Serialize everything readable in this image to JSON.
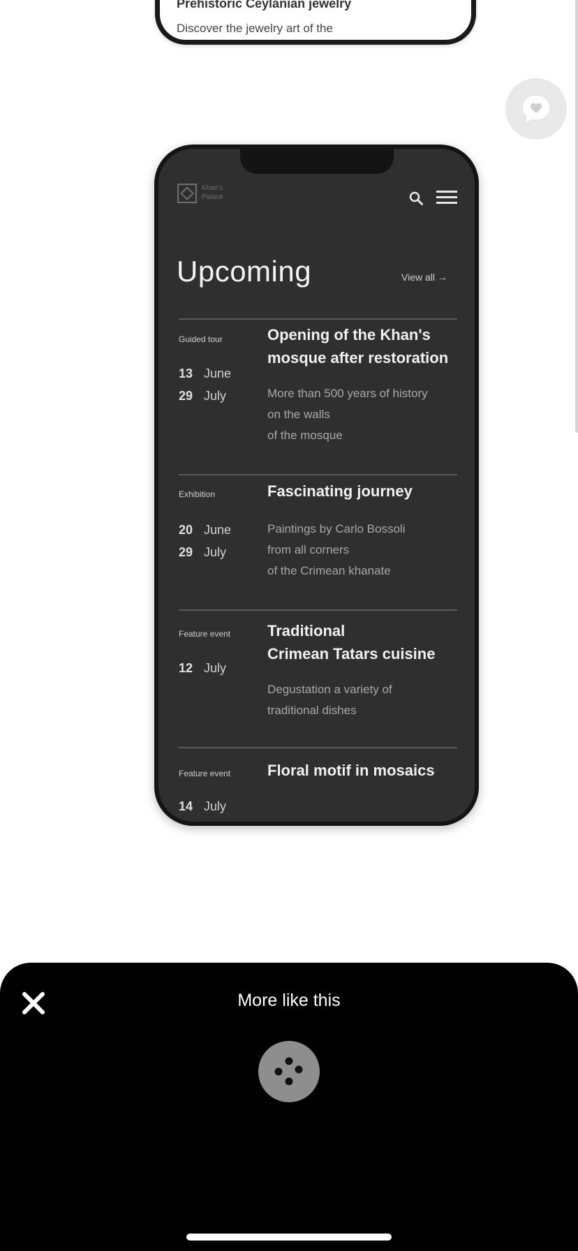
{
  "top_card": {
    "title": "Prehistoric Ceylanian jewelry",
    "description": "Discover the jewelry art of the"
  },
  "phone": {
    "logo_text_line1": "Khan's",
    "logo_text_line2": "Palace",
    "heading": "Upcoming",
    "view_all": "View all →",
    "events": [
      {
        "type": "Guided tour",
        "dates": [
          {
            "day": "13",
            "month": "June"
          },
          {
            "day": "29",
            "month": "July"
          }
        ],
        "title_line1": "Opening of the Khan's",
        "title_line2": "mosque after restoration",
        "desc_line1": "More than 500 years of history",
        "desc_line2": "on the walls",
        "desc_line3": "of the mosque"
      },
      {
        "type": "Exhibition",
        "dates": [
          {
            "day": "20",
            "month": "June"
          },
          {
            "day": "29",
            "month": "July"
          }
        ],
        "title_line1": "Fascinating journey",
        "desc_line1": "Paintings by Carlo Bossoli",
        "desc_line2": "from all corners",
        "desc_line3": "of the Crimean khanate"
      },
      {
        "type": "Feature event",
        "dates": [
          {
            "day": "12",
            "month": "July"
          }
        ],
        "title_line1": "Traditional",
        "title_line2": "Crimean Tatars cuisine",
        "desc_line1": "Degustation a variety of",
        "desc_line2": "traditional dishes"
      },
      {
        "type": "Feature event",
        "dates": [
          {
            "day": "14",
            "month": "July"
          }
        ],
        "title_line1": "Floral motif in mosaics"
      }
    ]
  },
  "sheet": {
    "title": "More like this"
  },
  "icons": {
    "close": "close-icon",
    "chat": "messenger-chat-icon",
    "loader": "loading-dots-icon",
    "search": "search-icon",
    "menu": "hamburger-menu-icon"
  },
  "colors": {
    "phone_bg": "#2f2f2f",
    "sheet_bg": "#000000",
    "fab_bg": "#e9e9e9"
  }
}
